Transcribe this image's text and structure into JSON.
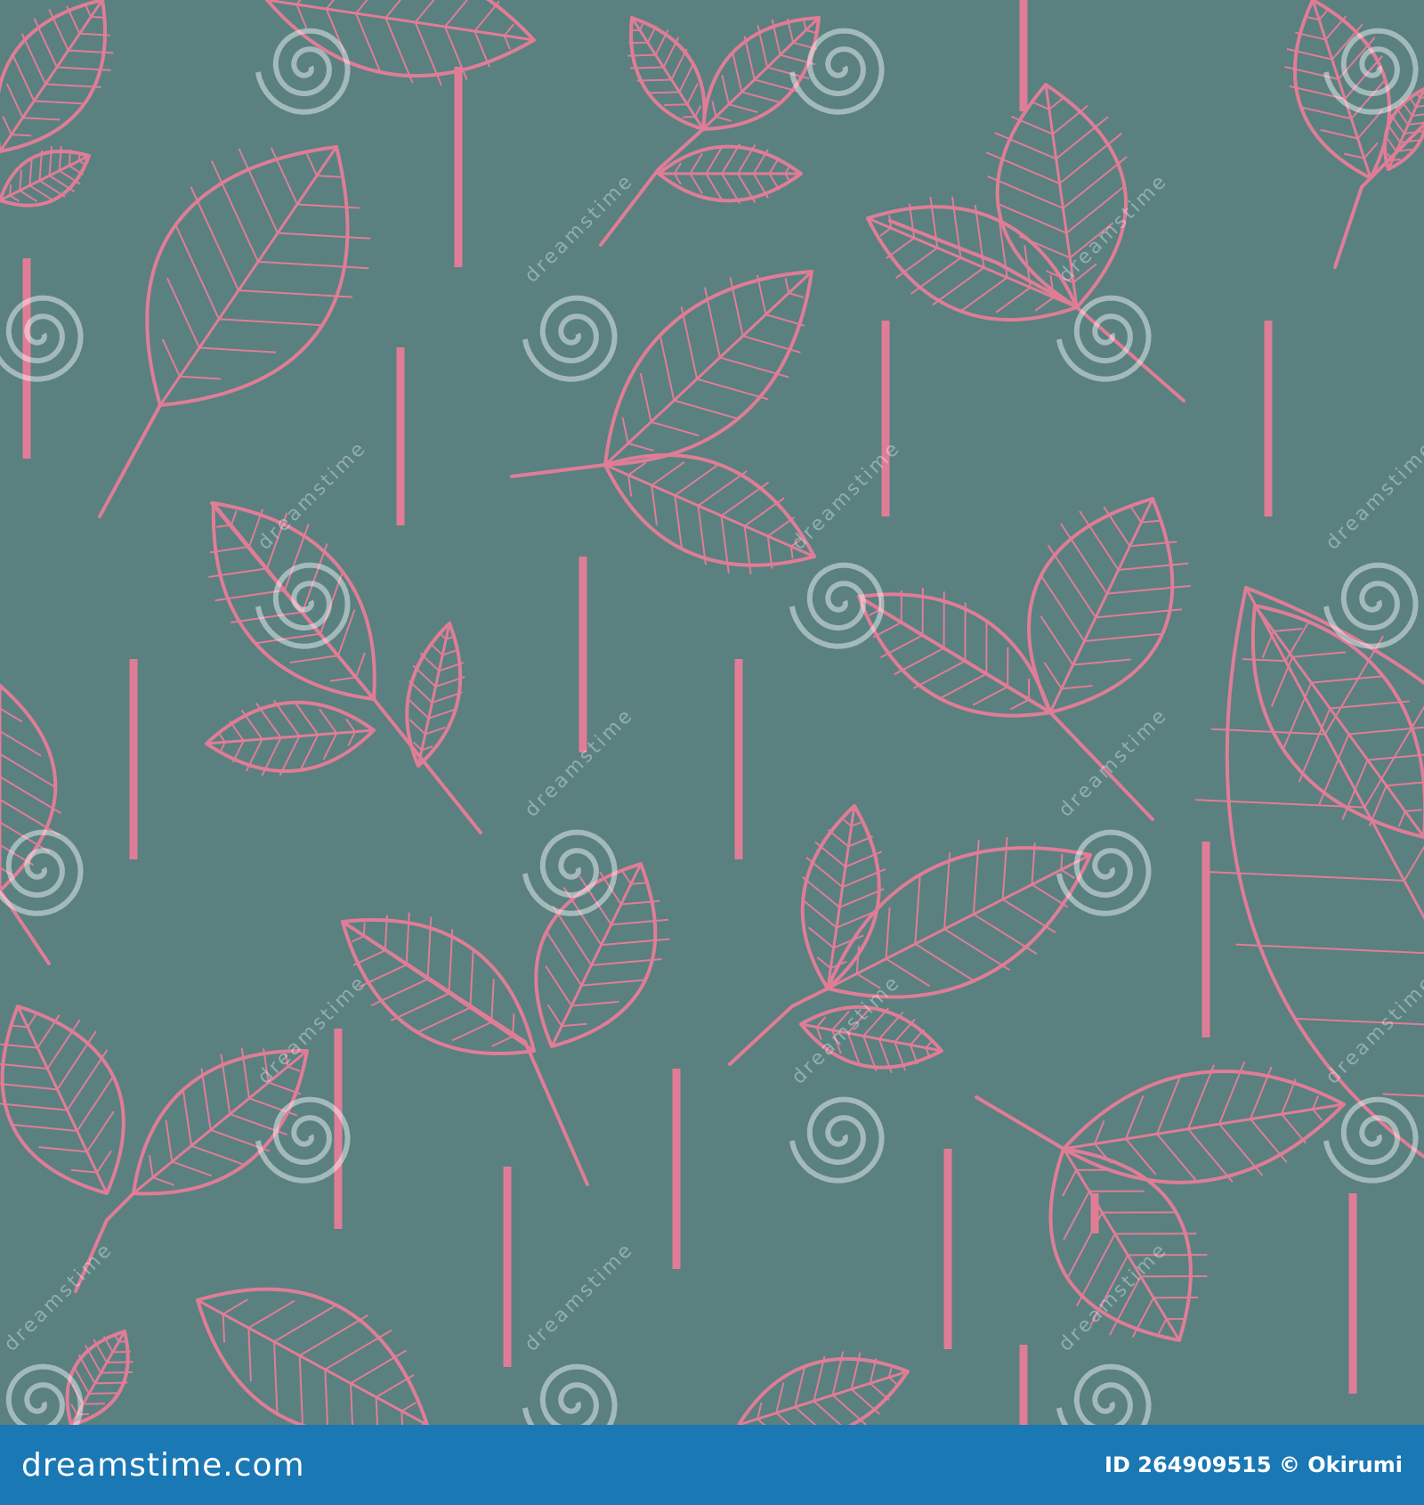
{
  "pattern": {
    "background_color": "#5a8080",
    "line_color": "#e07d96",
    "watermark_color": "#ffffff"
  },
  "watermark": {
    "text": "dreamstime"
  },
  "footer": {
    "background_color": "#1a78b4",
    "brand": "dreamstime.com",
    "credit": "ID 264909515 © Okirumi"
  }
}
